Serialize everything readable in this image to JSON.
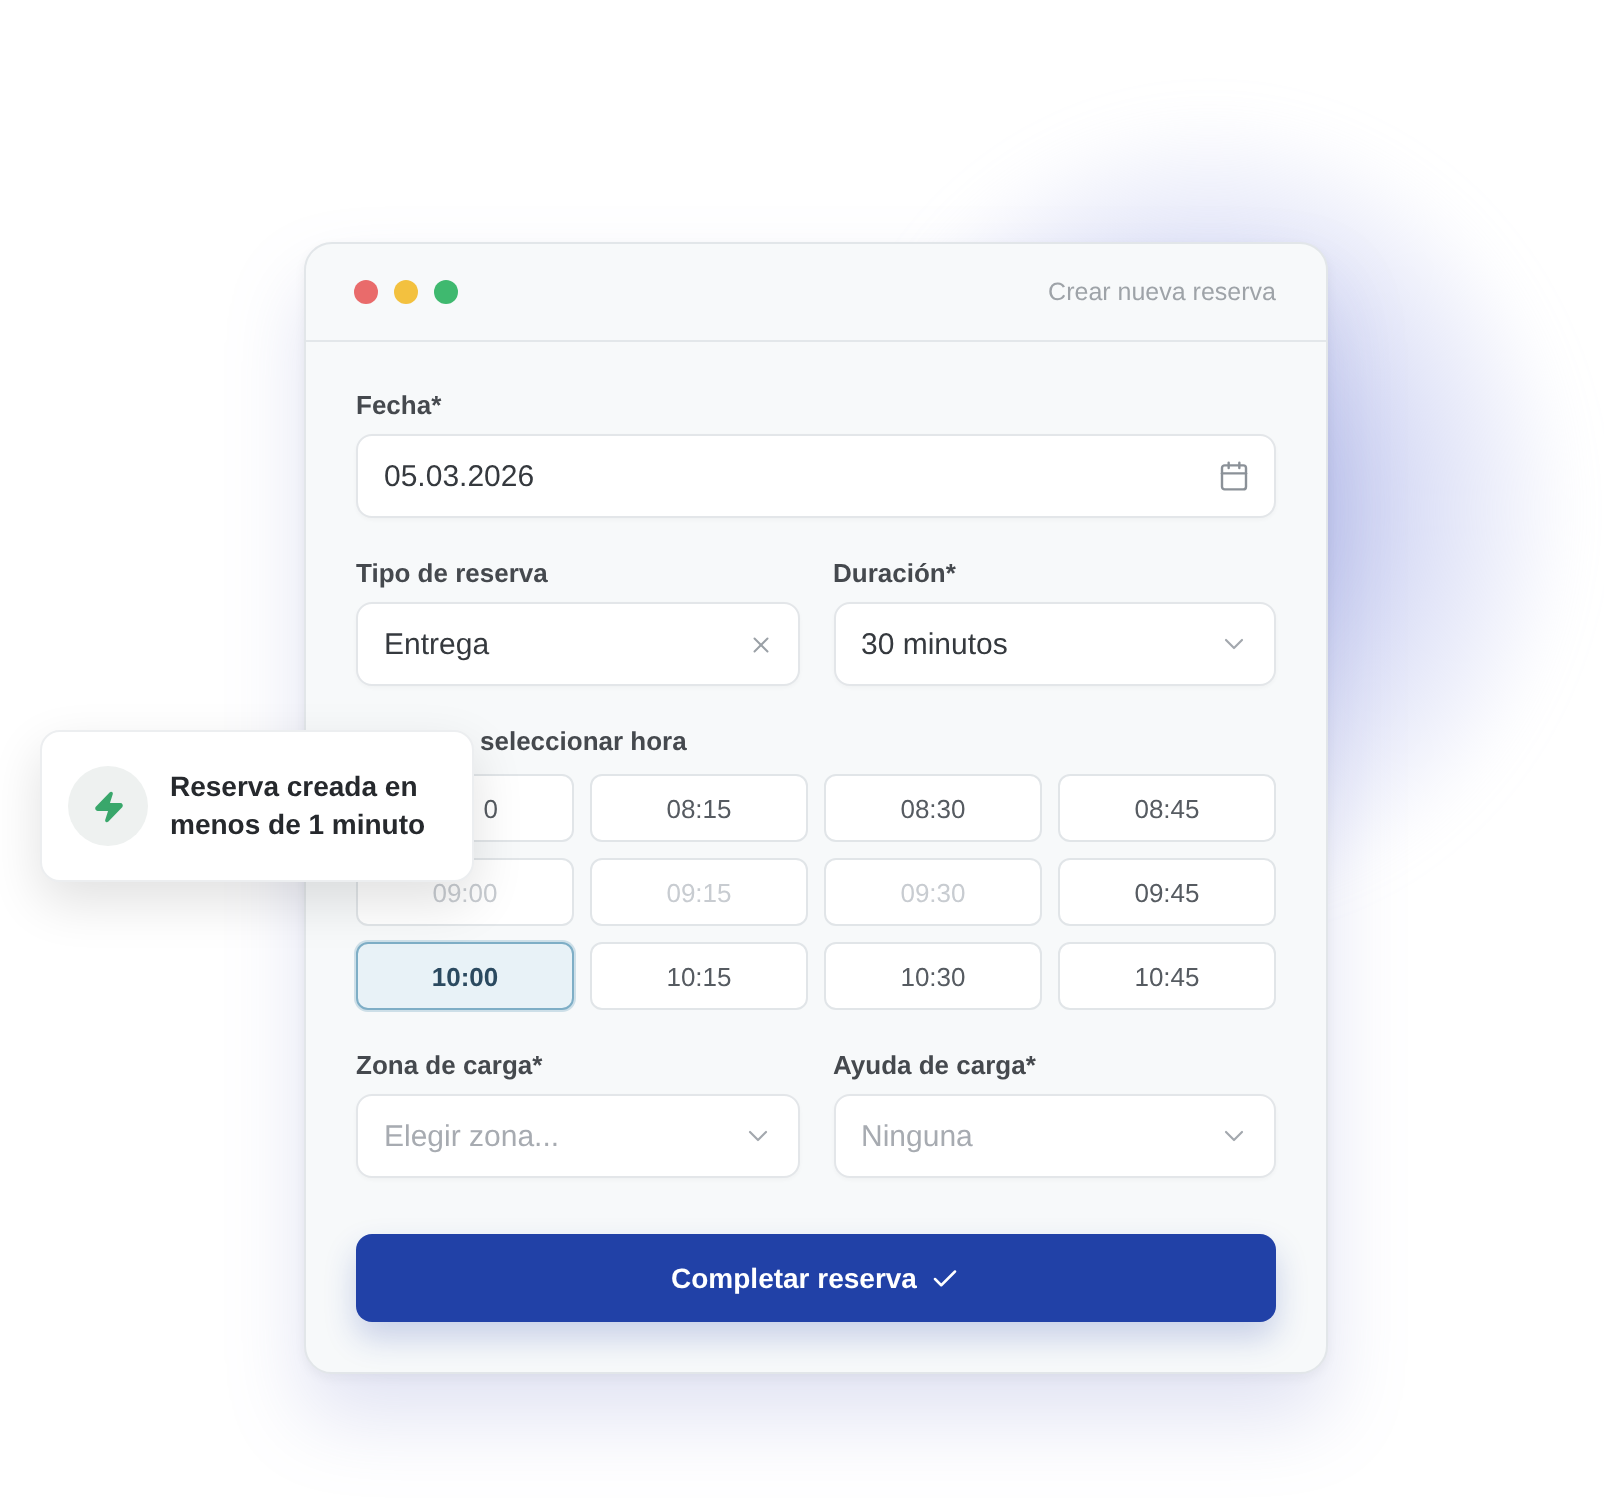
{
  "window": {
    "title": "Crear nueva reserva"
  },
  "form": {
    "date": {
      "kind": "date",
      "label": "Fecha*",
      "value": "05.03.2026"
    },
    "booking_type": {
      "kind": "clearable",
      "label": "Tipo de reserva",
      "value": "Entrega"
    },
    "duration": {
      "kind": "select",
      "label": "Duración*",
      "value": "30 minutos"
    },
    "time": {
      "label": "seleccionar hora",
      "slots": [
        {
          "label": "0",
          "kind": "partial",
          "selected": false,
          "disabled": false
        },
        {
          "label": "08:15",
          "kind": "time",
          "selected": false,
          "disabled": false
        },
        {
          "label": "08:30",
          "kind": "time",
          "selected": false,
          "disabled": false
        },
        {
          "label": "08:45",
          "kind": "time",
          "selected": false,
          "disabled": false
        },
        {
          "label": "09:00",
          "kind": "time",
          "selected": false,
          "disabled": true
        },
        {
          "label": "09:15",
          "kind": "time",
          "selected": false,
          "disabled": true
        },
        {
          "label": "09:30",
          "kind": "time",
          "selected": false,
          "disabled": true
        },
        {
          "label": "09:45",
          "kind": "time",
          "selected": false,
          "disabled": false
        },
        {
          "label": "10:00",
          "kind": "time",
          "selected": true,
          "disabled": false
        },
        {
          "label": "10:15",
          "kind": "time",
          "selected": false,
          "disabled": false
        },
        {
          "label": "10:30",
          "kind": "time",
          "selected": false,
          "disabled": false
        },
        {
          "label": "10:45",
          "kind": "time",
          "selected": false,
          "disabled": false
        }
      ]
    },
    "loading_zone": {
      "kind": "select",
      "label": "Zona de carga*",
      "placeholder": "Elegir zona..."
    },
    "loading_aid": {
      "kind": "select",
      "label": "Ayuda de carga*",
      "placeholder": "Ninguna"
    },
    "submit": {
      "label": "Completar reserva"
    }
  },
  "toast": {
    "text": "Reserva creada en menos de 1 minuto"
  }
}
